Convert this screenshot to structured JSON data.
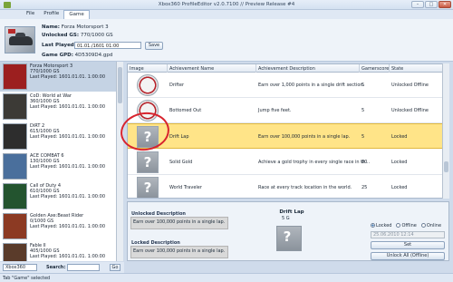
{
  "window": {
    "title": "Xbox360 ProfileEditor v2.0.7100 // Preview Release #4",
    "min": "–",
    "max": "□",
    "close": "✕"
  },
  "menu": [
    {
      "label": "File"
    },
    {
      "label": "Profile"
    },
    {
      "label": "Game"
    }
  ],
  "profile": {
    "name_label": "Name:",
    "name": "Forza Motorsport 3",
    "unlocked_gs_label": "Unlocked GS:",
    "unlocked_gs": "770/1000 GS",
    "last_played_label": "Last Played",
    "last_played": "01.01./1601 01:00",
    "game_gpd_label": "Game GPD:",
    "game_gpd": "4D5309D4.gpd",
    "set_label": "Save"
  },
  "games": [
    {
      "title": "Forza Motorsport 3",
      "gs": "770/1000 GS",
      "last": "Last Played: 1601.01.01. 1:00:00",
      "color": "#9c1f1f"
    },
    {
      "title": "CoD: World at War",
      "gs": "360/1000 GS",
      "last": "Last Played: 1601.01.01. 1:00:00",
      "color": "#3c3a36"
    },
    {
      "title": "DiRT 2",
      "gs": "615/1000 GS",
      "last": "Last Played: 1601.01.01. 1:00:00",
      "color": "#2d2d2d"
    },
    {
      "title": "ACE COMBAT 6",
      "gs": "130/1000 GS",
      "last": "Last Played: 1601.01.01. 1:00:00",
      "color": "#4a6f9c"
    },
    {
      "title": "Call of Duty 4",
      "gs": "610/1000 GS",
      "last": "Last Played: 1601.01.01. 1:00:00",
      "color": "#23542f"
    },
    {
      "title": "Golden Axe:Beast Rider",
      "gs": "0/1000 GS",
      "last": "Last Played: 1601.01.01. 1:00:00",
      "color": "#8c3a23"
    },
    {
      "title": "Fable II",
      "gs": "405/1000 GS",
      "last": "Last Played: 1601.01.01. 1:00:00",
      "color": "#5a3b2a"
    }
  ],
  "search": {
    "select": "Xbox360",
    "label": "Search:",
    "go": "Go"
  },
  "table": {
    "headers": {
      "image": "Image",
      "name": "Achievement Name",
      "desc": "Achievement Description",
      "gs": "Gamerscore",
      "state": "State"
    },
    "rows": [
      {
        "name": "Drifter",
        "desc": "Earn over 1,000 points in a single drift section.",
        "gs": "5",
        "state": "Unlocked Offline",
        "icon": "drifter-badge-icon"
      },
      {
        "name": "Bottomed Out",
        "desc": "Jump five feet.",
        "gs": "5",
        "state": "Unlocked Offline",
        "icon": "bottomed-out-badge-icon"
      },
      {
        "name": "Drift Lap",
        "desc": "Earn over 100,000 points in a single lap.",
        "gs": "5",
        "state": "Locked",
        "icon": "question-mark-icon"
      },
      {
        "name": "Solid Gold",
        "desc": "Achieve a gold trophy in every single race in th...",
        "gs": "80",
        "state": "Locked",
        "icon": "question-mark-icon"
      },
      {
        "name": "World Traveler",
        "desc": "Race at every track location in the world.",
        "gs": "25",
        "state": "Locked",
        "icon": "question-mark-icon"
      }
    ]
  },
  "detail": {
    "unlocked_label": "Unlocked Description",
    "unlocked_text": "Earn over 100,000 points in a single lap.",
    "locked_label": "Locked Description",
    "locked_text": "Earn over 100,000 points in a single lap.",
    "title": "Drift Lap",
    "gs": "5 G",
    "radio": {
      "locked": "Locked",
      "offline": "Offline",
      "online": "Online"
    },
    "date": "25.06.2010 12:14",
    "set_btn": "Set",
    "unlock_all_btn": "Unlock All (Offline)"
  },
  "status": "Tab \"Game\" selected"
}
